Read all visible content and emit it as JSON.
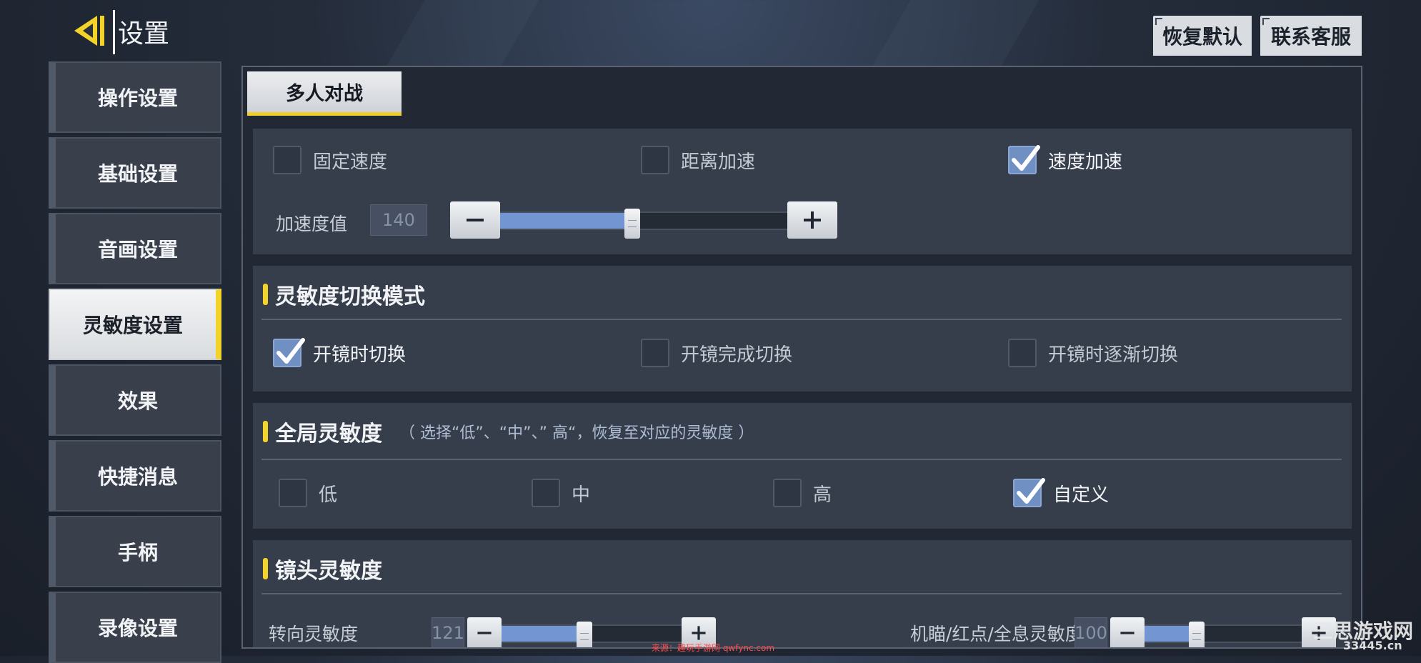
{
  "header": {
    "title": "设置",
    "restore_default": "恢复默认",
    "contact_service": "联系客服"
  },
  "sidebar": {
    "items": [
      {
        "label": "操作设置",
        "active": false
      },
      {
        "label": "基础设置",
        "active": false
      },
      {
        "label": "音画设置",
        "active": false
      },
      {
        "label": "灵敏度设置",
        "active": true
      },
      {
        "label": "效果",
        "active": false
      },
      {
        "label": "快捷消息",
        "active": false
      },
      {
        "label": "手柄",
        "active": false
      },
      {
        "label": "录像设置",
        "active": false
      }
    ]
  },
  "tabs": [
    {
      "label": "多人对战",
      "active": true
    }
  ],
  "accel": {
    "options": [
      {
        "label": "固定速度",
        "checked": false
      },
      {
        "label": "距离加速",
        "checked": false
      },
      {
        "label": "速度加速",
        "checked": true
      }
    ],
    "value_label": "加速度值",
    "value": "140",
    "slider_fraction": 0.46
  },
  "switch_mode": {
    "title": "灵敏度切换模式",
    "options": [
      {
        "label": "开镜时切换",
        "checked": true
      },
      {
        "label": "开镜完成切换",
        "checked": false
      },
      {
        "label": "开镜时逐渐切换",
        "checked": false
      }
    ]
  },
  "global_sens": {
    "title": "全局灵敏度",
    "note": "（ 选择“低”、“中”、” 高“，恢复至对应的灵敏度 ）",
    "options": [
      {
        "label": "低",
        "checked": false
      },
      {
        "label": "中",
        "checked": false
      },
      {
        "label": "高",
        "checked": false
      },
      {
        "label": "自定义",
        "checked": true
      }
    ]
  },
  "camera_sens": {
    "title": "镜头灵敏度",
    "rows": [
      {
        "label": "转向灵敏度",
        "value": "121",
        "slider_fraction": 0.46
      },
      {
        "label": "机瞄/红点/全息灵敏度",
        "value": "100",
        "slider_fraction": 0.33
      }
    ]
  },
  "colors": {
    "accent": "#f2d32a",
    "checkbox_on": "#7090c4",
    "slider_fill": "#7396d2"
  },
  "icons": {
    "back": "back-arrow-icon",
    "check": "check-icon",
    "minus": "minus-icon",
    "plus": "plus-icon"
  },
  "watermark": {
    "site": "三思游戏网",
    "domain": "33445.cn",
    "source": "来源：趣玩手游网 qwfync.com"
  }
}
